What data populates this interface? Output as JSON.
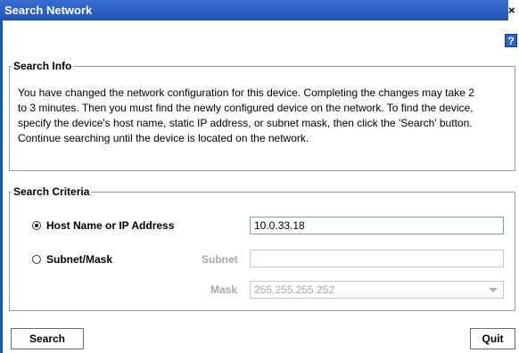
{
  "window": {
    "title": "Search Network",
    "close_glyph": "×",
    "help_glyph": "?"
  },
  "search_info": {
    "legend": "Search Info",
    "message": "You have changed the network configuration for this device. Completing the changes may take 2 to 3 minutes.  Then you must find the newly configured device on the network. To find the device, specify the device's host name, static IP address, or subnet mask, then click the 'Search' button. Continue searching until the device is located on the network."
  },
  "search_criteria": {
    "legend": "Search Criteria",
    "options": {
      "host": {
        "label": "Host Name or IP Address",
        "selected": true,
        "value": "10.0.33.18"
      },
      "subnet": {
        "label": "Subnet/Mask",
        "selected": false,
        "subnet_label": "Subnet",
        "subnet_value": "",
        "mask_label": "Mask",
        "mask_value": "255.255.255.252"
      }
    }
  },
  "buttons": {
    "search": "Search",
    "quit": "Quit"
  },
  "colors": {
    "titlebar": "#1f52b7",
    "disabled_text": "#a8a8a8"
  }
}
